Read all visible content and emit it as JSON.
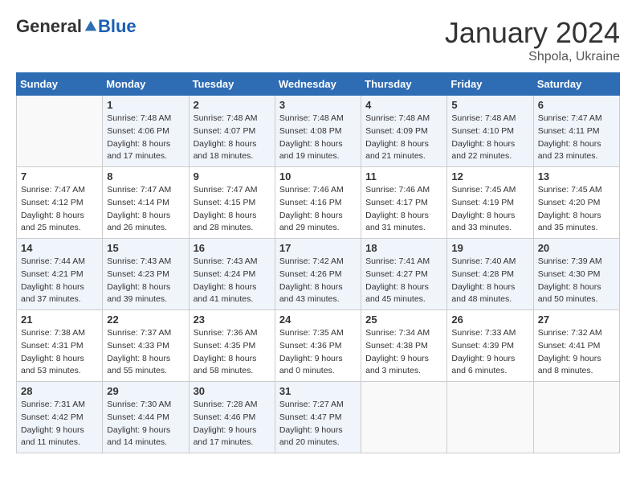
{
  "header": {
    "logo_general": "General",
    "logo_blue": "Blue",
    "month_title": "January 2024",
    "subtitle": "Shpola, Ukraine"
  },
  "weekdays": [
    "Sunday",
    "Monday",
    "Tuesday",
    "Wednesday",
    "Thursday",
    "Friday",
    "Saturday"
  ],
  "weeks": [
    [
      {
        "day": "",
        "sunrise": "",
        "sunset": "",
        "daylight": ""
      },
      {
        "day": "1",
        "sunrise": "Sunrise: 7:48 AM",
        "sunset": "Sunset: 4:06 PM",
        "daylight": "Daylight: 8 hours and 17 minutes."
      },
      {
        "day": "2",
        "sunrise": "Sunrise: 7:48 AM",
        "sunset": "Sunset: 4:07 PM",
        "daylight": "Daylight: 8 hours and 18 minutes."
      },
      {
        "day": "3",
        "sunrise": "Sunrise: 7:48 AM",
        "sunset": "Sunset: 4:08 PM",
        "daylight": "Daylight: 8 hours and 19 minutes."
      },
      {
        "day": "4",
        "sunrise": "Sunrise: 7:48 AM",
        "sunset": "Sunset: 4:09 PM",
        "daylight": "Daylight: 8 hours and 21 minutes."
      },
      {
        "day": "5",
        "sunrise": "Sunrise: 7:48 AM",
        "sunset": "Sunset: 4:10 PM",
        "daylight": "Daylight: 8 hours and 22 minutes."
      },
      {
        "day": "6",
        "sunrise": "Sunrise: 7:47 AM",
        "sunset": "Sunset: 4:11 PM",
        "daylight": "Daylight: 8 hours and 23 minutes."
      }
    ],
    [
      {
        "day": "7",
        "sunrise": "Sunrise: 7:47 AM",
        "sunset": "Sunset: 4:12 PM",
        "daylight": "Daylight: 8 hours and 25 minutes."
      },
      {
        "day": "8",
        "sunrise": "Sunrise: 7:47 AM",
        "sunset": "Sunset: 4:14 PM",
        "daylight": "Daylight: 8 hours and 26 minutes."
      },
      {
        "day": "9",
        "sunrise": "Sunrise: 7:47 AM",
        "sunset": "Sunset: 4:15 PM",
        "daylight": "Daylight: 8 hours and 28 minutes."
      },
      {
        "day": "10",
        "sunrise": "Sunrise: 7:46 AM",
        "sunset": "Sunset: 4:16 PM",
        "daylight": "Daylight: 8 hours and 29 minutes."
      },
      {
        "day": "11",
        "sunrise": "Sunrise: 7:46 AM",
        "sunset": "Sunset: 4:17 PM",
        "daylight": "Daylight: 8 hours and 31 minutes."
      },
      {
        "day": "12",
        "sunrise": "Sunrise: 7:45 AM",
        "sunset": "Sunset: 4:19 PM",
        "daylight": "Daylight: 8 hours and 33 minutes."
      },
      {
        "day": "13",
        "sunrise": "Sunrise: 7:45 AM",
        "sunset": "Sunset: 4:20 PM",
        "daylight": "Daylight: 8 hours and 35 minutes."
      }
    ],
    [
      {
        "day": "14",
        "sunrise": "Sunrise: 7:44 AM",
        "sunset": "Sunset: 4:21 PM",
        "daylight": "Daylight: 8 hours and 37 minutes."
      },
      {
        "day": "15",
        "sunrise": "Sunrise: 7:43 AM",
        "sunset": "Sunset: 4:23 PM",
        "daylight": "Daylight: 8 hours and 39 minutes."
      },
      {
        "day": "16",
        "sunrise": "Sunrise: 7:43 AM",
        "sunset": "Sunset: 4:24 PM",
        "daylight": "Daylight: 8 hours and 41 minutes."
      },
      {
        "day": "17",
        "sunrise": "Sunrise: 7:42 AM",
        "sunset": "Sunset: 4:26 PM",
        "daylight": "Daylight: 8 hours and 43 minutes."
      },
      {
        "day": "18",
        "sunrise": "Sunrise: 7:41 AM",
        "sunset": "Sunset: 4:27 PM",
        "daylight": "Daylight: 8 hours and 45 minutes."
      },
      {
        "day": "19",
        "sunrise": "Sunrise: 7:40 AM",
        "sunset": "Sunset: 4:28 PM",
        "daylight": "Daylight: 8 hours and 48 minutes."
      },
      {
        "day": "20",
        "sunrise": "Sunrise: 7:39 AM",
        "sunset": "Sunset: 4:30 PM",
        "daylight": "Daylight: 8 hours and 50 minutes."
      }
    ],
    [
      {
        "day": "21",
        "sunrise": "Sunrise: 7:38 AM",
        "sunset": "Sunset: 4:31 PM",
        "daylight": "Daylight: 8 hours and 53 minutes."
      },
      {
        "day": "22",
        "sunrise": "Sunrise: 7:37 AM",
        "sunset": "Sunset: 4:33 PM",
        "daylight": "Daylight: 8 hours and 55 minutes."
      },
      {
        "day": "23",
        "sunrise": "Sunrise: 7:36 AM",
        "sunset": "Sunset: 4:35 PM",
        "daylight": "Daylight: 8 hours and 58 minutes."
      },
      {
        "day": "24",
        "sunrise": "Sunrise: 7:35 AM",
        "sunset": "Sunset: 4:36 PM",
        "daylight": "Daylight: 9 hours and 0 minutes."
      },
      {
        "day": "25",
        "sunrise": "Sunrise: 7:34 AM",
        "sunset": "Sunset: 4:38 PM",
        "daylight": "Daylight: 9 hours and 3 minutes."
      },
      {
        "day": "26",
        "sunrise": "Sunrise: 7:33 AM",
        "sunset": "Sunset: 4:39 PM",
        "daylight": "Daylight: 9 hours and 6 minutes."
      },
      {
        "day": "27",
        "sunrise": "Sunrise: 7:32 AM",
        "sunset": "Sunset: 4:41 PM",
        "daylight": "Daylight: 9 hours and 8 minutes."
      }
    ],
    [
      {
        "day": "28",
        "sunrise": "Sunrise: 7:31 AM",
        "sunset": "Sunset: 4:42 PM",
        "daylight": "Daylight: 9 hours and 11 minutes."
      },
      {
        "day": "29",
        "sunrise": "Sunrise: 7:30 AM",
        "sunset": "Sunset: 4:44 PM",
        "daylight": "Daylight: 9 hours and 14 minutes."
      },
      {
        "day": "30",
        "sunrise": "Sunrise: 7:28 AM",
        "sunset": "Sunset: 4:46 PM",
        "daylight": "Daylight: 9 hours and 17 minutes."
      },
      {
        "day": "31",
        "sunrise": "Sunrise: 7:27 AM",
        "sunset": "Sunset: 4:47 PM",
        "daylight": "Daylight: 9 hours and 20 minutes."
      },
      {
        "day": "",
        "sunrise": "",
        "sunset": "",
        "daylight": ""
      },
      {
        "day": "",
        "sunrise": "",
        "sunset": "",
        "daylight": ""
      },
      {
        "day": "",
        "sunrise": "",
        "sunset": "",
        "daylight": ""
      }
    ]
  ]
}
